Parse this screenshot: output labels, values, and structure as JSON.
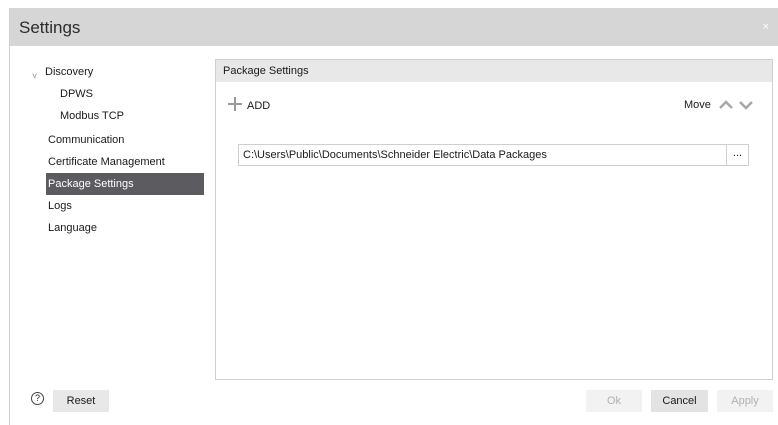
{
  "window": {
    "title": "Settings",
    "close_glyph": "×"
  },
  "nav": {
    "expand_icon": "˅",
    "items": [
      {
        "label": "Discovery"
      },
      {
        "label": "DPWS"
      },
      {
        "label": "Modbus TCP"
      },
      {
        "label": "Communication"
      },
      {
        "label": "Certificate Management"
      },
      {
        "label": "Package Settings",
        "selected": true
      },
      {
        "label": "Logs"
      },
      {
        "label": "Language"
      }
    ]
  },
  "panel": {
    "header": "Package Settings",
    "add_label": "ADD",
    "move_label": "Move",
    "paths": [
      "C:\\Users\\Public\\Documents\\Schneider Electric\\Data Packages"
    ],
    "browse_label": "..."
  },
  "footer": {
    "help_glyph": "?",
    "reset": "Reset",
    "ok": "Ok",
    "cancel": "Cancel",
    "apply": "Apply"
  },
  "colors": {
    "title_bar": "#d6d6d6",
    "selected_item": "#5b5b60",
    "panel_header": "#e8e8e8"
  }
}
